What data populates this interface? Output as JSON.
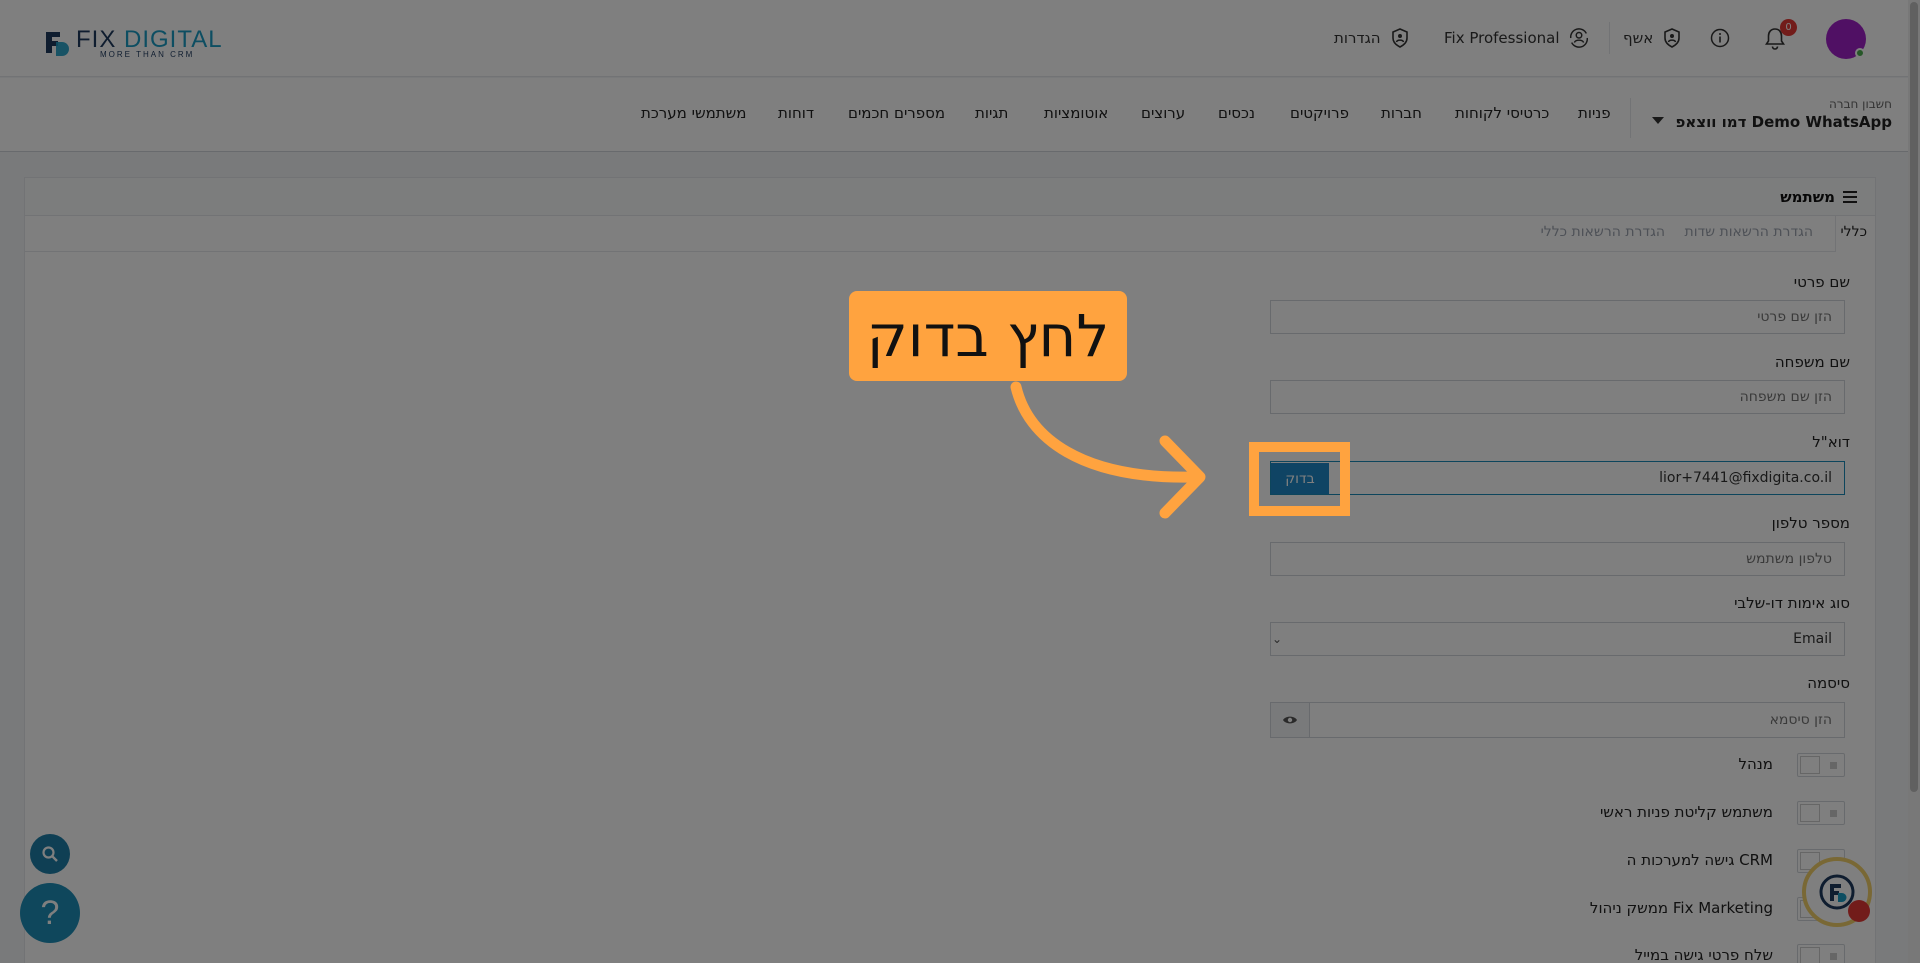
{
  "header": {
    "logo_main": "FIX",
    "logo_highlight": "DIGITAL",
    "logo_tagline": "MORE THAN CRM",
    "settings_label": "הגדרות",
    "fix_professional_label": "Fix Professional",
    "user_label": "אשף",
    "notification_count": "0"
  },
  "navbar": {
    "company_label": "חשבון חברה",
    "company_value": "דמו ווצאפ Demo WhatsApp",
    "items": [
      "פניות",
      "כרטיסי לקוחות",
      "חברות",
      "פרויקטים",
      "נכסים",
      "ערוצים",
      "אוטומציות",
      "תגיות",
      "מספרים חכמים",
      "דוחות",
      "משתמשי מערכת"
    ]
  },
  "card": {
    "title": "משתמש",
    "tabs": [
      "כללי",
      "הגדרת הרשאות שדות",
      "הגדרת הרשאות כללי"
    ]
  },
  "form": {
    "first_name_label": "שם פרטי",
    "first_name_placeholder": "הזן שם פרטי",
    "last_name_label": "שם משפחה",
    "last_name_placeholder": "הזן שם משפחה",
    "email_label": "דוא\"ל",
    "email_value": "lior+7441@fixdigita.co.il",
    "check_button": "בדוק",
    "phone_label": "מספר טלפון",
    "phone_placeholder": "טלפון משתמש",
    "twofa_label": "סוג אימות דו-שלבי",
    "twofa_value": "Email",
    "password_label": "סיסמה",
    "password_placeholder": "הזן סיסמא",
    "toggles": [
      "מנהל",
      "משתמש קליטת פניות ראשי",
      "גישה למערכות ה CRM",
      "ממשק ניהול Fix Marketing",
      "שלח פרטי גישה במייל"
    ]
  },
  "overlay": {
    "callout_text": "לחץ בדוק"
  },
  "help": {
    "help_symbol": "?"
  },
  "colors": {
    "accent": "#1e88c8",
    "callout": "#ffa33f",
    "avatar": "#a020c8"
  }
}
